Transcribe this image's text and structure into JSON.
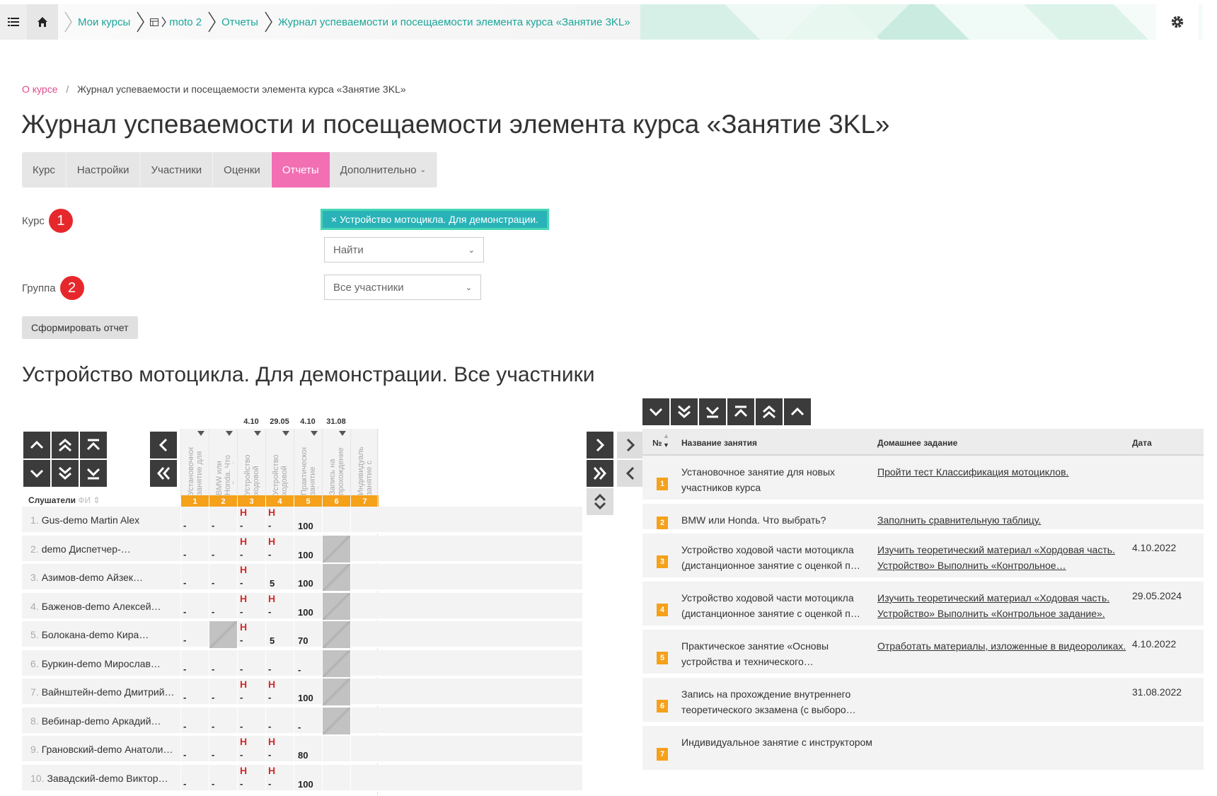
{
  "topnav": {
    "crumbs": [
      "Мои курсы",
      "moto 2",
      "Отчеты",
      "Журнал успеваемости и посещаемости элемента курса «Занятие 3KL»"
    ]
  },
  "breadcrumb": {
    "home": "О курсе",
    "sep": "/",
    "current": "Журнал успеваемости и посещаемости элемента курса «Занятие 3KL»"
  },
  "page_title": "Журнал успеваемости и посещаемости элемента курса «Занятие 3KL»",
  "tabs": [
    {
      "label": "Курс",
      "active": false
    },
    {
      "label": "Настройки",
      "active": false
    },
    {
      "label": "Участники",
      "active": false
    },
    {
      "label": "Оценки",
      "active": false
    },
    {
      "label": "Отчеты",
      "active": true
    },
    {
      "label": "Дополнительно",
      "active": false
    }
  ],
  "form": {
    "course_label": "Курс",
    "course_badge": "1",
    "course_tag": "× Устройство мотоцикла. Для демонстрации.",
    "search_placeholder": "Найти",
    "group_label": "Группа",
    "group_badge": "2",
    "group_value": "Все участники",
    "submit": "Сформировать отчет"
  },
  "report_title": "Устройство мотоцикла. Для демонстрации. Все участники",
  "journal": {
    "students_header": "Слушатели",
    "fi_label": "ФИ",
    "columns": [
      {
        "num": "1",
        "date": "",
        "title": "Установочное занятие для новых участников курса"
      },
      {
        "num": "2",
        "date": "",
        "title": "BMW или Honda. Что выбрать?"
      },
      {
        "num": "3",
        "date": "4.10",
        "title": "Устройство ходовой части мотоцикла"
      },
      {
        "num": "4",
        "date": "29.05",
        "title": "Устройство ходовой части мотоцикла"
      },
      {
        "num": "5",
        "date": "4.10",
        "title": "Практическое занятие «Основы"
      },
      {
        "num": "6",
        "date": "31.08",
        "title": "Запись на прохождение внутреннего"
      },
      {
        "num": "7",
        "date": "",
        "title": "Индивидуальное занятие с инструктором"
      }
    ],
    "rows": [
      {
        "n": "1.",
        "name": "Gus-demo Martin Alex",
        "c1": "-",
        "c2": "-",
        "c3": "-",
        "h3": "Н",
        "c4": "-",
        "h4": "Н",
        "c5": "100",
        "g6": false
      },
      {
        "n": "2.",
        "name": "demo Диспетчер-…",
        "c1": "-",
        "c2": "-",
        "c3": "-",
        "h3": "Н",
        "c4": "-",
        "h4": "Н",
        "c5": "100",
        "g6": true
      },
      {
        "n": "3.",
        "name": "Азимов-demo Айзек…",
        "c1": "-",
        "c2": "-",
        "c3": "-",
        "h3": "Н",
        "c4": "5",
        "h4": "",
        "c5": "100",
        "g6": true
      },
      {
        "n": "4.",
        "name": "Баженов-demo Алексей…",
        "c1": "-",
        "c2": "-",
        "c3": "-",
        "h3": "Н",
        "c4": "-",
        "h4": "Н",
        "c5": "100",
        "g6": true
      },
      {
        "n": "5.",
        "name": "Болокана-demo Кира…",
        "c1": "-",
        "c2": "",
        "c3": "-",
        "h3": "Н",
        "c4": "5",
        "h4": "",
        "c5": "70",
        "g6": true
      },
      {
        "n": "6.",
        "name": "Буркин-demo Мирослав…",
        "c1": "-",
        "c2": "-",
        "c3": "-",
        "h3": "",
        "c4": "-",
        "h4": "",
        "c5": "-",
        "g6": true
      },
      {
        "n": "7.",
        "name": "Вайнштейн-demo Дмитрий…",
        "c1": "-",
        "c2": "-",
        "c3": "-",
        "h3": "Н",
        "c4": "-",
        "h4": "Н",
        "c5": "100",
        "g6": true
      },
      {
        "n": "8.",
        "name": "Вебинар-demo Аркадий…",
        "c1": "-",
        "c2": "-",
        "c3": "-",
        "h3": "",
        "c4": "-",
        "h4": "",
        "c5": "-",
        "g6": true
      },
      {
        "n": "9.",
        "name": "Грановский-demo Анатолий…",
        "c1": "-",
        "c2": "-",
        "c3": "-",
        "h3": "Н",
        "c4": "-",
        "h4": "Н",
        "c5": "80",
        "g6": false
      },
      {
        "n": "10.",
        "name": "Завадский-demo Виктор…",
        "c1": "-",
        "c2": "-",
        "c3": "-",
        "h3": "Н",
        "c4": "-",
        "h4": "Н",
        "c5": "100",
        "g6": false
      }
    ]
  },
  "lessons": {
    "headers": {
      "num": "№",
      "name": "Название занятия",
      "homework": "Домашнее задание",
      "date": "Дата"
    },
    "rows": [
      {
        "num": "1",
        "name": "Установочное занятие для новых участников курса",
        "homework": "Пройти тест Классификация мотоциклов.",
        "date": ""
      },
      {
        "num": "2",
        "name": "BMW или Honda. Что выбрать?",
        "homework": "Заполнить сравнительную таблицу.",
        "date": ""
      },
      {
        "num": "3",
        "name": "Устройство ходовой части мотоцикла (дистанционное занятие с оценкой п…",
        "homework": "Изучить теоретический материал «Хордовая часть. Устройство» Выполнить «Контрольное…",
        "date": "4.10.2022"
      },
      {
        "num": "4",
        "name": "Устройство ходовой части мотоцикла (дистанционное занятие с оценкой п…",
        "homework": "Изучить теоретический материал «Ходовая часть. Устройство» Выполнить «Контрольное задание».",
        "date": "29.05.2024"
      },
      {
        "num": "5",
        "name": "Практическое занятие «Основы устройства и технического…",
        "homework": "Отработать материалы, изложенные в видеороликах.",
        "date": "4.10.2022"
      },
      {
        "num": "6",
        "name": "Запись на прохождение внутреннего теоретического экзамена (с выборо…",
        "homework": "",
        "date": "31.08.2022"
      },
      {
        "num": "7",
        "name": "Индивидуальное занятие с инструктором",
        "homework": "",
        "date": ""
      }
    ]
  },
  "colors": {
    "accent": "#f26fb4",
    "teal": "#1aa59a",
    "badge": "#e6282d",
    "column_num": "#f5a11a",
    "absent": "#d62b2b"
  }
}
